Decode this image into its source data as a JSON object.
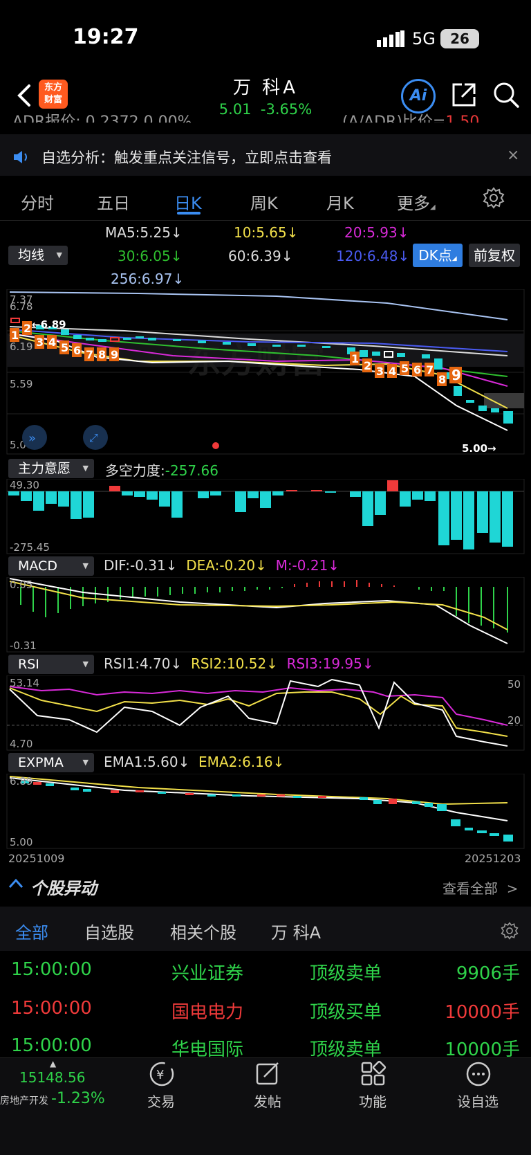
{
  "status": {
    "time": "19:27",
    "network": "5G",
    "battery": "26"
  },
  "header": {
    "logo": "东方财富",
    "name": "万 科A",
    "price": "5.01",
    "change_pct": "-3.65%",
    "ai_label": "Ai"
  },
  "adr": {
    "left": "ADR报价: 0.2372  0.00%",
    "right_label": "(A/ADR)比价=",
    "right_value": "1.50"
  },
  "notice": {
    "text": "自选分析：触发重点关注信号，立即点击查看",
    "close": "×"
  },
  "tabs": [
    {
      "label": "分时"
    },
    {
      "label": "五日"
    },
    {
      "label": "日K"
    },
    {
      "label": "周K"
    },
    {
      "label": "月K"
    },
    {
      "label": "更多"
    }
  ],
  "main_chart": {
    "selector": "均线",
    "ma": [
      {
        "label": "MA5:5.25↓",
        "color": "#ffffff"
      },
      {
        "label": "10:5.65↓",
        "color": "#f2e04a"
      },
      {
        "label": "20:5.93↓",
        "color": "#d92ad9"
      },
      {
        "label": "30:6.05↓",
        "color": "#2fc02f"
      },
      {
        "label": "60:6.39↓",
        "color": "#dddddd"
      },
      {
        "label": "120:6.48↓",
        "color": "#4a5bf2"
      },
      {
        "label": "256:6.97↓",
        "color": "#a9c4f2"
      }
    ],
    "dk_label": "DK点",
    "fq_label": "前复权",
    "y_top": "7.37",
    "y_mid1": "6.78",
    "y_mid2": "6.19",
    "y_mid3": "5.59",
    "y_bottom": "5.00",
    "high_mark": "6.89",
    "low_mark": "5.00",
    "seq_a": [
      "1",
      "2",
      "3",
      "4",
      "5",
      "6",
      "7",
      "8",
      "9"
    ],
    "seq_b": [
      "1",
      "2",
      "3",
      "4",
      "5",
      "6",
      "7",
      "8",
      "9"
    ],
    "watermark": "东方财富"
  },
  "power_chart": {
    "selector": "主力意愿",
    "label": "多空力度:",
    "value": "-257.66",
    "y_top": "49.30",
    "y_bottom": "-275.45"
  },
  "macd_chart": {
    "selector": "MACD",
    "dif": "DIF:-0.31↓",
    "dea": "DEA:-0.20↓",
    "m": "M:-0.21↓",
    "y_top": "0.05",
    "y_bottom": "-0.31"
  },
  "rsi_chart": {
    "selector": "RSI",
    "rsi1": "RSI1:4.70↓",
    "rsi2": "RSI2:10.52↓",
    "rsi3": "RSI3:19.95↓",
    "y_top": "53.14",
    "y_bottom": "4.70",
    "r50": "50",
    "r20": "20"
  },
  "expma_chart": {
    "selector": "EXPMA",
    "ema1": "EMA1:5.60↓",
    "ema2": "EMA2:6.16↓",
    "y_top": "6.89",
    "y_bottom": "5.00",
    "date_start": "20251009",
    "date_end": "20251203"
  },
  "movement": {
    "title": "个股异动",
    "view_all": "查看全部",
    "subtabs": [
      {
        "label": "全部"
      },
      {
        "label": "自选股"
      },
      {
        "label": "相关个股"
      },
      {
        "label": "万 科A"
      }
    ],
    "rows": [
      {
        "time": "15:00:00",
        "name": "兴业证券",
        "type": "顶级卖单",
        "vol": "9906手",
        "color": "#2fd34a"
      },
      {
        "time": "15:00:00",
        "name": "国电电力",
        "type": "顶级买单",
        "vol": "10000手",
        "color": "#f03a3a"
      },
      {
        "time": "15:00:00",
        "name": "华电国际",
        "type": "顶级卖单",
        "vol": "10000手",
        "color": "#2fd34a"
      }
    ]
  },
  "bottom": {
    "index_value": "15148.56",
    "index_name": "房地产开发",
    "index_change": "-1.23%",
    "nav": [
      {
        "label": "交易"
      },
      {
        "label": "发帖"
      },
      {
        "label": "功能"
      },
      {
        "label": "设自选"
      }
    ]
  }
}
